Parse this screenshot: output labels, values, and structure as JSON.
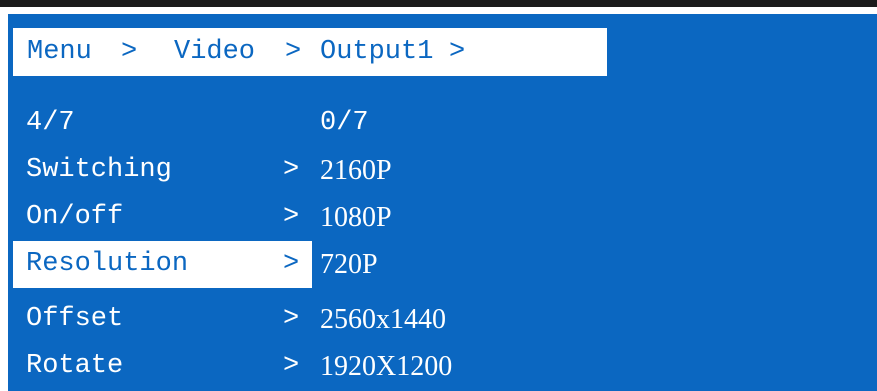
{
  "breadcrumb": {
    "items": [
      "Menu",
      "Video",
      "Output1"
    ],
    "separator": ">"
  },
  "left_list": {
    "position": "4/7",
    "items": [
      {
        "label": "Switching",
        "chevron": ">"
      },
      {
        "label": "On/off",
        "chevron": ">"
      },
      {
        "label": "Resolution",
        "chevron": ">",
        "selected": true
      },
      {
        "label": "Offset",
        "chevron": ">"
      },
      {
        "label": "Rotate",
        "chevron": ">"
      }
    ]
  },
  "right_list": {
    "position": "0/7",
    "items": [
      "2160P",
      "1080P",
      "720P",
      "2560x1440",
      "1920X1200"
    ]
  },
  "colors": {
    "screen_background": "#0b67c1",
    "text": "#ffffff",
    "highlight": "#ffffff",
    "top_rule": "#1b1b1b"
  }
}
